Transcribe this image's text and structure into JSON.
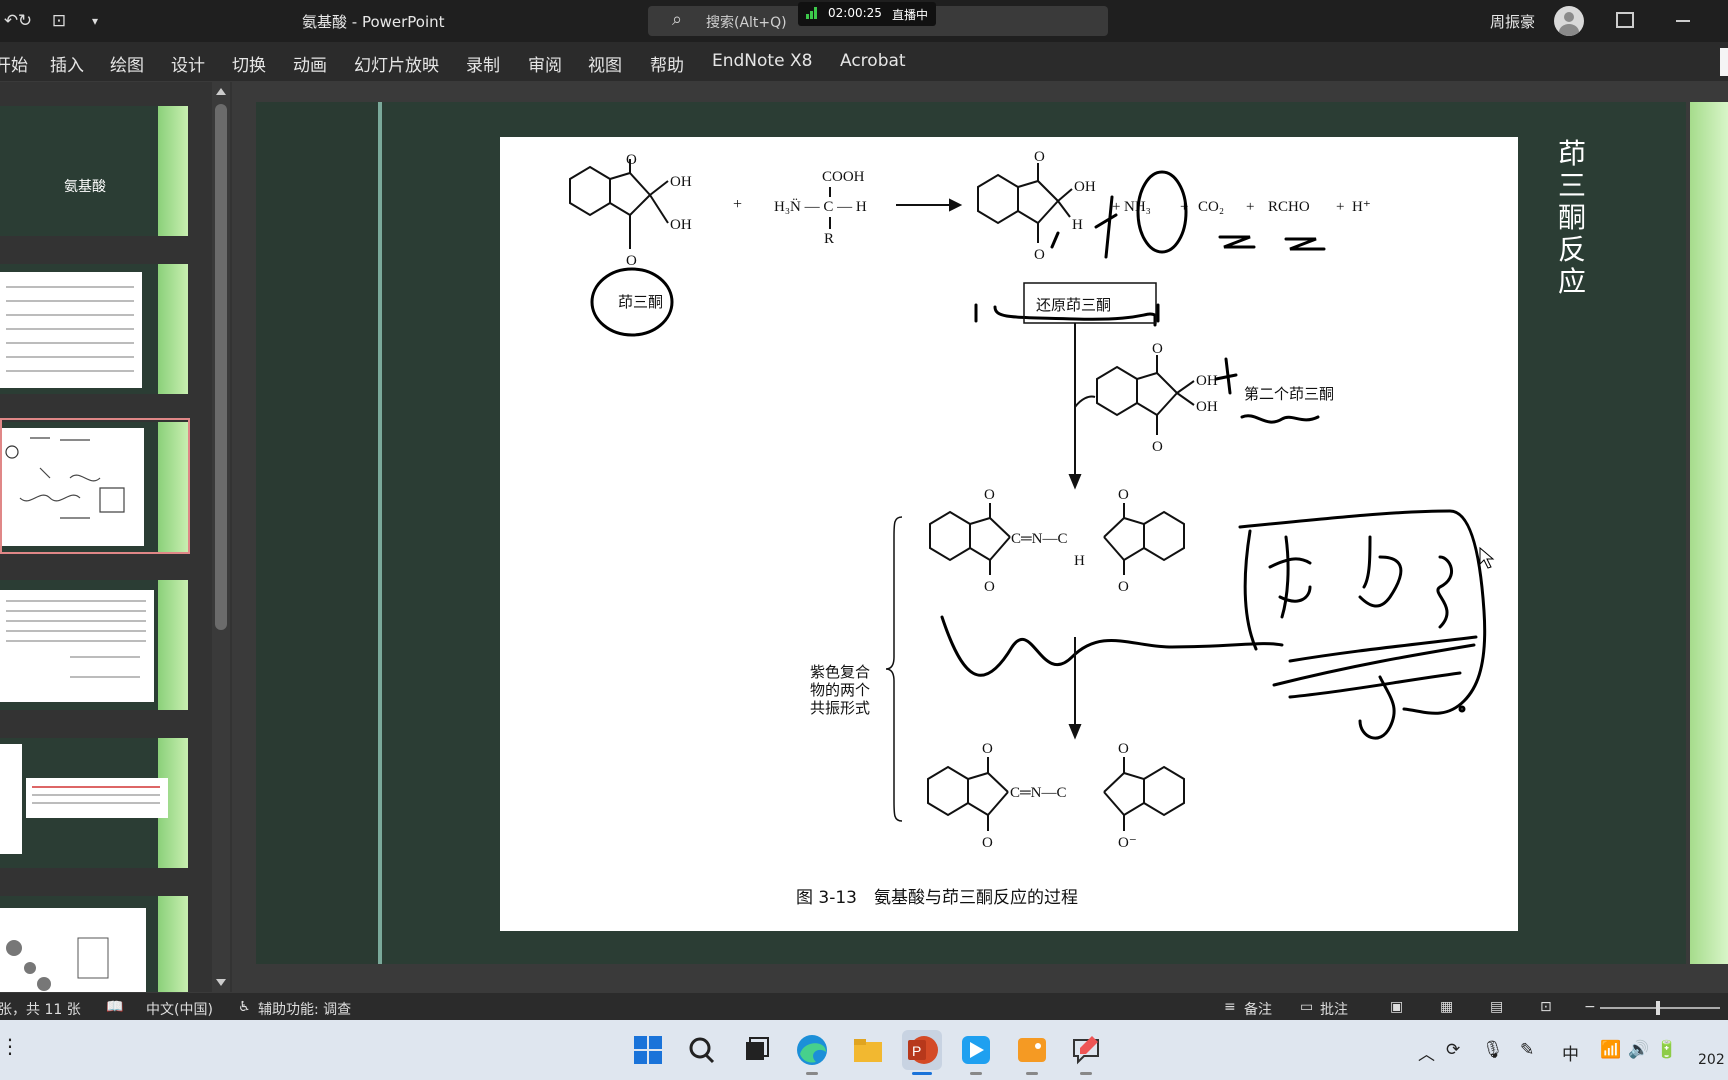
{
  "titlebar": {
    "title": "氨基酸 - PowerPoint",
    "search_placeholder": "搜索(Alt+Q)",
    "live_time": "02:00:25",
    "live_label": "直播中",
    "user_name": "周振豪"
  },
  "menu": {
    "items": [
      "开始",
      "插入",
      "绘图",
      "设计",
      "切换",
      "动画",
      "幻灯片放映",
      "录制",
      "审阅",
      "视图",
      "帮助",
      "EndNote X8",
      "Acrobat"
    ]
  },
  "thumbnails": {
    "title_slide_text": "氨基酸",
    "selected_index": 3
  },
  "slide": {
    "title": "茚三酮反应",
    "figure": {
      "oh1": "OH",
      "oh2": "OH",
      "o_top": "O",
      "o_bot": "O",
      "c1": "C",
      "c2": "C",
      "c3": "C",
      "plus1": "+",
      "cooh": "COOH",
      "amine": "H₃N̈ — C — H",
      "r": "R",
      "prod_oh": "OH",
      "prod_h": "H",
      "nh3": "NH₃",
      "co2": "CO₂",
      "rcho": "RCHO",
      "hplus": "H⁺",
      "label_ninhydrin": "茚三酮",
      "label_reduced": "还原茚三酮",
      "label_second": "第二个茚三酮",
      "label_purple_1": "紫色复合",
      "label_purple_2": "物的两个",
      "label_purple_3": "共振形式",
      "n_mid": "C═N—C",
      "h_mid": "H",
      "n_bottom": "C═N—C",
      "o_minus": "O⁻",
      "caption": "图 3-13　氨基酸与茚三酮反应的过程"
    }
  },
  "status": {
    "slide_count": "张，共 11 张",
    "language": "中文(中国)",
    "accessibility": "辅助功能: 调查",
    "notes": "备注",
    "comments": "批注"
  },
  "taskbar": {
    "ime": "中",
    "clock_partial": "202"
  }
}
